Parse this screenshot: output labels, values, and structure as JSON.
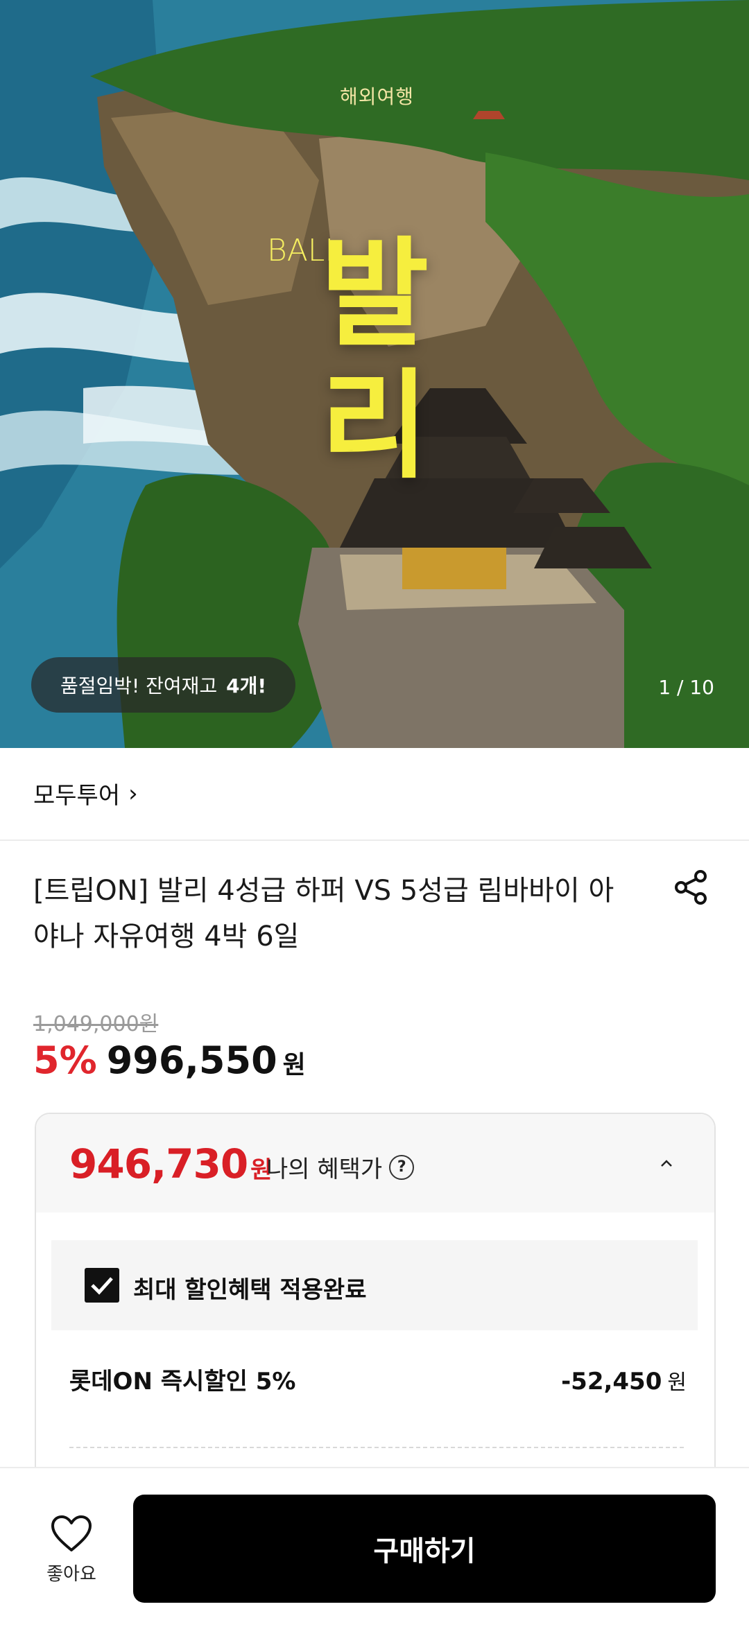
{
  "hero": {
    "subtitle": "해외여행",
    "side_text": "BALI",
    "big_text_line1": "발",
    "big_text_line2": "리",
    "stock_text": "품절임박! 잔여재고",
    "stock_count": "4개!",
    "image_counter": "1 / 10"
  },
  "seller": {
    "name": "모두투어",
    "chevron": "›"
  },
  "product": {
    "title": "[트립ON] 발리 4성급 하퍼 VS 5성급 림바바이 아야나 자유여행 4박 6일",
    "original_price": "1,049,000원",
    "discount_rate": "5%",
    "sale_price": "996,550",
    "sale_currency": "원"
  },
  "benefit": {
    "price": "946,730",
    "currency": "원",
    "label": "나의 혜택가",
    "help_mark": "?",
    "applied_text": "최대 할인혜택 적용완료",
    "items": [
      {
        "label": "롯데ON 즉시할인 5%",
        "amount": "-52,450",
        "currency": "원"
      }
    ]
  },
  "bottom_bar": {
    "like_label": "좋아요",
    "buy_label": "구매하기"
  },
  "colors": {
    "accent_red": "#d91f26",
    "buy_button": "#000000",
    "hero_text_yellow": "#f6ee3e"
  },
  "icons": [
    "share-icon",
    "chevron-up-icon",
    "checkbox-checked-icon",
    "heart-icon",
    "question-icon"
  ]
}
